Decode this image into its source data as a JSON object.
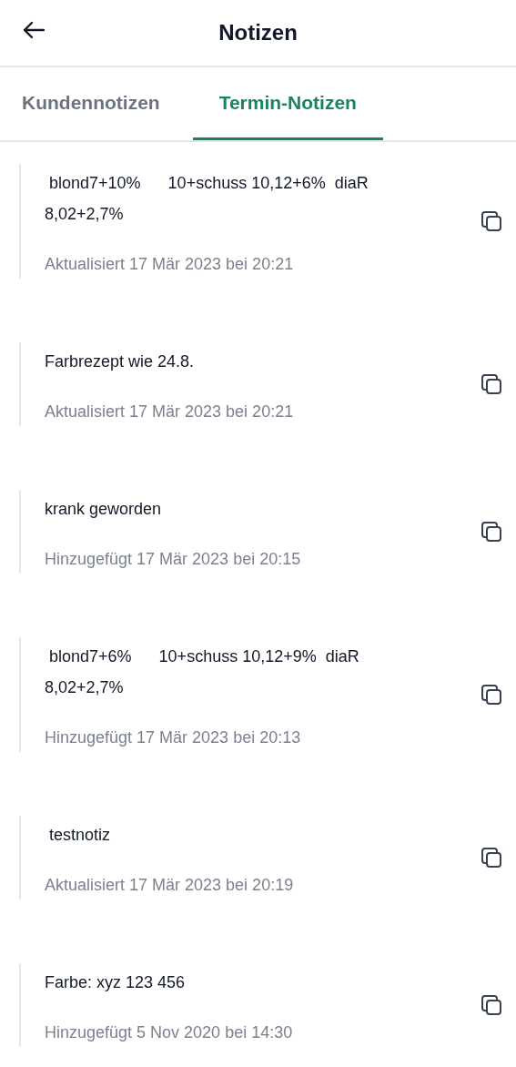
{
  "header": {
    "title": "Notizen"
  },
  "tabs": [
    {
      "label": "Kundennotizen",
      "selected": false
    },
    {
      "label": "Termin-Notizen",
      "selected": true
    }
  ],
  "notes": [
    {
      "text": " blond7+10%      10+schuss 10,12+6%  diaR\n8,02+2,7%",
      "meta": "Aktualisiert 17 Mär 2023 bei 20:21"
    },
    {
      "text": "Farbrezept wie 24.8.",
      "meta": "Aktualisiert 17 Mär 2023 bei 20:21"
    },
    {
      "text": "krank geworden",
      "meta": "Hinzugefügt 17 Mär 2023 bei 20:15"
    },
    {
      "text": " blond7+6%      10+schuss 10,12+9%  diaR\n8,02+2,7%",
      "meta": "Hinzugefügt 17 Mär 2023 bei 20:13"
    },
    {
      "text": " testnotiz",
      "meta": "Aktualisiert 17 Mär 2023 bei 20:19"
    },
    {
      "text": "Farbe: xyz 123 456",
      "meta": "Hinzugefügt 5 Nov 2020 bei 14:30"
    }
  ]
}
